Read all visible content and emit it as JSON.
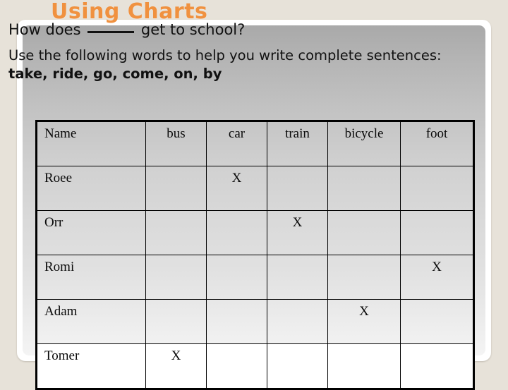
{
  "slide": {
    "title": "Using Charts",
    "title_color": "#f0913f",
    "background_color": "#e7e2d9",
    "panel_color_top": "#a9a9a9",
    "panel_color_bottom": "#f4f4f4"
  },
  "prompt": {
    "question_before_blank": "How does ",
    "question_after_blank": " get to school?",
    "instruction_lead": "Use the following words to help you write complete sentences: ",
    "word_list": "take, ride, go, come, on, by"
  },
  "chart_data": {
    "type": "table",
    "title": "How does ____ get to school?",
    "columns": [
      "Name",
      "bus",
      "car",
      "train",
      "bicycle",
      "foot"
    ],
    "rows": [
      {
        "name": "Roee",
        "marks": [
          "",
          "X",
          "",
          "",
          ""
        ]
      },
      {
        "name": "Orr",
        "marks": [
          "",
          "",
          "X",
          "",
          ""
        ]
      },
      {
        "name": "Romi",
        "marks": [
          "",
          "",
          "",
          "",
          "X"
        ]
      },
      {
        "name": "Adam",
        "marks": [
          "",
          "",
          "",
          "X",
          ""
        ]
      },
      {
        "name": "Tomer",
        "marks": [
          "X",
          "",
          "",
          "",
          ""
        ]
      }
    ],
    "mark_symbol": "X",
    "categories": [
      "bus",
      "car",
      "train",
      "bicycle",
      "foot"
    ],
    "values": [
      1,
      1,
      1,
      1,
      1
    ],
    "xlabel": "",
    "ylabel": ""
  }
}
